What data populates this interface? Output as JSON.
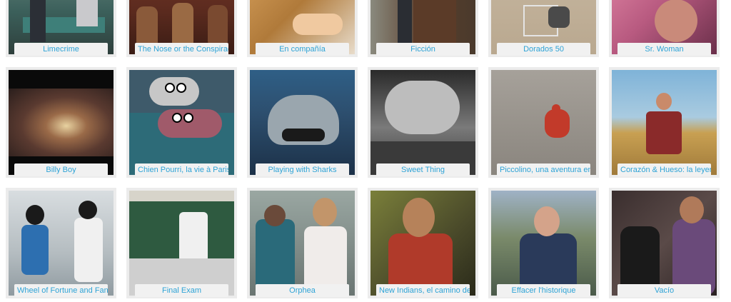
{
  "films": [
    [
      {
        "title": "Limecrime",
        "image": "two people sitting on a green bench"
      },
      {
        "title": "The Nose or the Conspiracy of Mavericks",
        "image": "animated painted crowd"
      },
      {
        "title": "En compañía",
        "image": "hand petting a dog"
      },
      {
        "title": "Ficción",
        "image": "man in front of a wooden door"
      },
      {
        "title": "Dorados 50",
        "image": "person on a beach chair"
      },
      {
        "title": "Sr. Woman",
        "image": "woman in pink light"
      }
    ],
    [
      {
        "title": "Billy Boy",
        "image": "close-up of an eye"
      },
      {
        "title": "Chien Pourri, la vie à Paris",
        "image": "cartoon dog and cat"
      },
      {
        "title": "Playing with Sharks",
        "image": "shark underwater"
      },
      {
        "title": "Sweet Thing",
        "image": "black and white face in water"
      },
      {
        "title": "Piccolino, una aventura en la ciudad",
        "image": "red cricket on pavement"
      },
      {
        "title": "Corazón & Hueso: la leyenda de",
        "image": "boy in a field"
      }
    ],
    [
      {
        "title": "Wheel of Fortune and Fantasy",
        "image": "two women on a street"
      },
      {
        "title": "Final Exam",
        "image": "classroom with students"
      },
      {
        "title": "Orphea",
        "image": "woman and man on a street"
      },
      {
        "title": "New Indians, el camino del grupo",
        "image": "man with sunglasses"
      },
      {
        "title": "Effacer l'historique",
        "image": "group of people sitting"
      },
      {
        "title": "Vacío",
        "image": "couple looking at a phone"
      }
    ]
  ],
  "colors": {
    "label_text": "#2ea3d6",
    "label_bg": "#f1f1f1",
    "card_border": "#ececec"
  }
}
